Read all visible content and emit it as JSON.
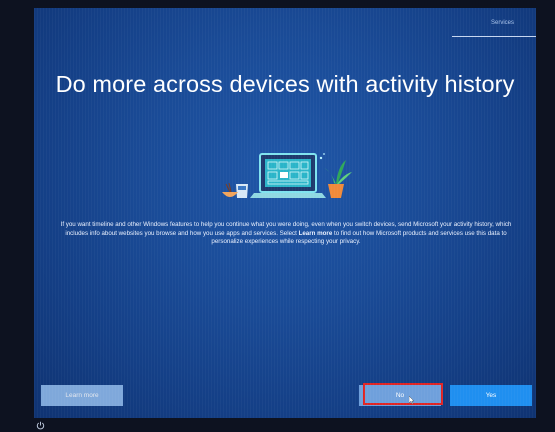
{
  "header": {
    "step_label": "Services"
  },
  "main": {
    "title": "Do more across devices with activity history",
    "description_part1": "If you want timeline and other Windows features to help you continue what you were doing, even when you switch devices, send Microsoft your activity history, which includes info about websites you browse and how you use apps and services. Select ",
    "description_bold": "Learn more",
    "description_part2": " to find out how Microsoft products and services use this data to personalize experiences while respecting your privacy."
  },
  "footer": {
    "learn_more_label": "Learn more",
    "no_label": "No",
    "yes_label": "Yes"
  },
  "colors": {
    "accent": "#1f8ff0",
    "background": "#1a4b97",
    "highlight_box": "#e02424"
  },
  "icons": {
    "illustration": "laptop-plant-illustration-icon",
    "power": "power-icon",
    "cursor": "mouse-cursor-icon"
  }
}
